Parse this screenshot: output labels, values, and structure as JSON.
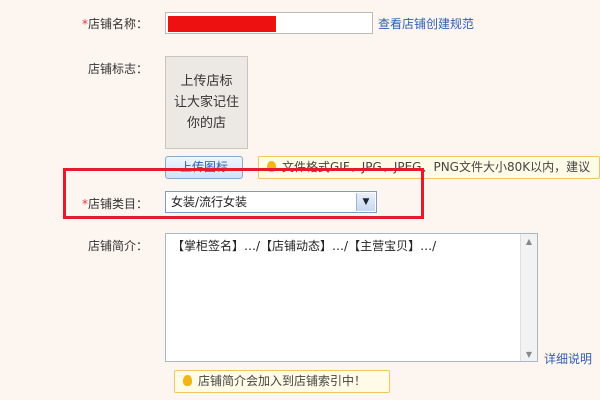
{
  "form": {
    "shop_name": {
      "required_mark": "*",
      "label": "店铺名称：",
      "help_link": "查看店铺创建规范"
    },
    "shop_logo": {
      "label": "店铺标志：",
      "placeholder_lines": [
        "上传店标",
        "让大家记住",
        "你的店"
      ],
      "upload_button": "上传图标",
      "tip": "文件格式GIF、JPG、JPEG、PNG文件大小80K以内，建议"
    },
    "shop_category": {
      "required_mark": "*",
      "label": "店铺类目：",
      "selected_value": "女装/流行女装"
    },
    "shop_intro": {
      "label": "店铺简介：",
      "value": "【掌柜签名】…/【店铺动态】…/【主营宝贝】…/",
      "detail_link": "详细说明",
      "tip": "店铺简介会加入到店铺索引中！"
    }
  },
  "icons": {
    "tip": "lightbulb-icon",
    "select_arrow": "chevron-down-icon"
  },
  "colors": {
    "required": "#e4393c",
    "link": "#2d5fb5",
    "highlight_frame": "#e8192c",
    "redaction": "#ee1111"
  }
}
